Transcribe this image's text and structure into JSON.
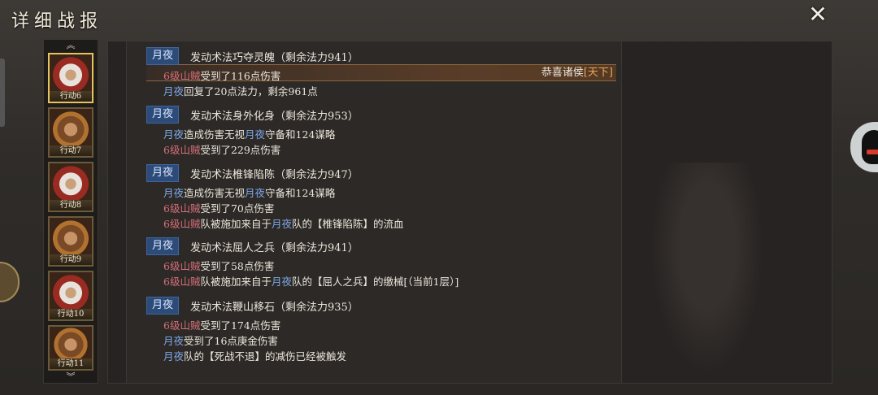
{
  "title": "详细战报",
  "sidebar": {
    "avatars": [
      {
        "label": "行动6"
      },
      {
        "label": "行动7"
      },
      {
        "label": "行动8"
      },
      {
        "label": "行动9"
      },
      {
        "label": "行动10"
      },
      {
        "label": "行动11"
      }
    ]
  },
  "notification": {
    "text": "恭喜诸侯",
    "highlight": "[天下]"
  },
  "log": {
    "blocks": [
      {
        "tag": "月夜",
        "head": "发动术法巧夺灵魄（剩余法力941）",
        "lines": [
          {
            "enemy": "6级山贼",
            "text": "受到了116点伤害"
          },
          {
            "ally": "月夜",
            "text": "回复了20点法力，剩余961点"
          }
        ]
      },
      {
        "tag": "月夜",
        "head": "发动术法身外化身（剩余法力953）",
        "lines": [
          {
            "ally": "月夜",
            "text": "造成伤害无视",
            "ally2": "月夜",
            "text2": "守备和124谋略"
          },
          {
            "enemy": "6级山贼",
            "text": "受到了229点伤害"
          }
        ]
      },
      {
        "tag": "月夜",
        "head": "发动术法椎锋陷陈（剩余法力947）",
        "lines": [
          {
            "ally": "月夜",
            "text": "造成伤害无视",
            "ally2": "月夜",
            "text2": "守备和124谋略"
          },
          {
            "enemy": "6级山贼",
            "text": "受到了70点伤害"
          },
          {
            "enemy": "6级山贼",
            "text": "队被施加来自于",
            "ally2": "月夜",
            "text2": "队的【椎锋陷陈】的流血"
          }
        ]
      },
      {
        "tag": "月夜",
        "head": "发动术法屈人之兵（剩余法力941）",
        "lines": [
          {
            "enemy": "6级山贼",
            "text": "受到了58点伤害"
          },
          {
            "enemy": "6级山贼",
            "text": "队被施加来自于",
            "ally2": "月夜",
            "text2": "队的【屈人之兵】的缴械[（当前1层）]"
          }
        ]
      },
      {
        "tag": "月夜",
        "head": "发动术法鞭山移石（剩余法力935）",
        "lines": [
          {
            "enemy": "6级山贼",
            "text": "受到了174点伤害"
          },
          {
            "ally": "月夜",
            "text": "受到了16点庚金伤害"
          },
          {
            "ally": "月夜",
            "text": "队的【死战不退】的减伤已经被触发"
          }
        ]
      }
    ]
  },
  "colors": {
    "ally": "#7fa8e6",
    "enemy": "#d9707a",
    "tag_bg": "#2d4b78",
    "notify_highlight": "#e7a557"
  },
  "icons": {
    "close": "close-icon",
    "scroll_up": "chevron-up-icon",
    "scroll_down": "chevron-down-icon",
    "qq": "penguin-icon"
  }
}
